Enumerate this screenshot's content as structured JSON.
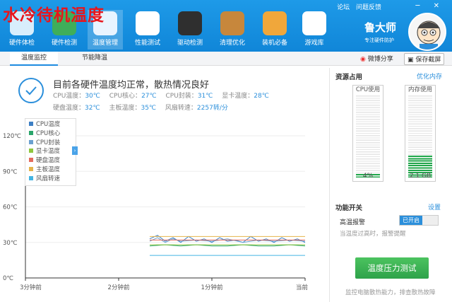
{
  "overlay_title": "水冷待机温度",
  "header": {
    "nav": [
      {
        "label": "硬件体检",
        "icon": "monitor-icon",
        "color": "#d8eefc"
      },
      {
        "label": "硬件检测",
        "icon": "board-icon",
        "color": "#3fae5a"
      },
      {
        "label": "温度管理",
        "icon": "temperature-chart-icon",
        "color": "#e8f4ff"
      },
      {
        "label": "性能测试",
        "icon": "gauge-icon",
        "color": "#ffffff"
      },
      {
        "label": "驱动检测",
        "icon": "gear-icon",
        "color": "#2f2f2f"
      },
      {
        "label": "清理优化",
        "icon": "broom-icon",
        "color": "#c7873c"
      },
      {
        "label": "装机必备",
        "icon": "box-icon",
        "color": "#f0a73b"
      },
      {
        "label": "游戏库",
        "icon": "gamepad-icon",
        "color": "#ffffff"
      }
    ],
    "links": [
      "论坛",
      "问题反馈"
    ],
    "window_controls": "─ ✕",
    "brand_name": "鲁大师",
    "brand_sub": "专注硬件防护"
  },
  "tabs": {
    "temperature": "温度监控",
    "energy": "节能降温",
    "share": "微博分享",
    "screenshot": "保存截屏"
  },
  "status": {
    "message": "目前各硬件温度均正常，散热情况良好",
    "cpu_temp": "CPU温度：",
    "cpu_temp_v": "30℃",
    "cpu_core": "CPU核心：",
    "cpu_core_v": "27℃",
    "cpu_pkg": "CPU封装：",
    "cpu_pkg_v": "31℃",
    "gpu_temp": "显卡温度：",
    "gpu_temp_v": "28℃",
    "disk_temp": "硬盘温度：",
    "disk_temp_v": "32℃",
    "board_temp": "主板温度：",
    "board_temp_v": "35℃",
    "fan_speed": "风扇转速：",
    "fan_speed_v": "2257转/分"
  },
  "chart_data": {
    "type": "line",
    "y_ticks": [
      "120℃",
      "90℃",
      "60℃",
      "30℃",
      "0℃"
    ],
    "x_ticks": [
      "3分钟前",
      "2分钟前",
      "1分钟前",
      "当前"
    ],
    "ylim": [
      0,
      120
    ],
    "x_range": [
      -180,
      0
    ],
    "grid": true,
    "legend_position": "top-left",
    "legend": [
      "CPU温度",
      "CPU核心",
      "CPU封装",
      "显卡温度",
      "硬盘温度",
      "主板温度",
      "风扇转速"
    ],
    "series": [
      {
        "name": "CPU温度",
        "color": "#3d7fc4",
        "values": [
          [
            -100,
            33
          ],
          [
            -95,
            36
          ],
          [
            -90,
            31
          ],
          [
            -85,
            34
          ],
          [
            -80,
            30
          ],
          [
            -75,
            35
          ],
          [
            -70,
            31
          ],
          [
            -65,
            33
          ],
          [
            -60,
            30
          ],
          [
            -55,
            34
          ],
          [
            -50,
            31
          ],
          [
            -45,
            32
          ],
          [
            -40,
            30
          ],
          [
            -35,
            35
          ],
          [
            -30,
            31
          ],
          [
            -25,
            33
          ],
          [
            -20,
            30
          ],
          [
            -15,
            34
          ],
          [
            -10,
            31
          ],
          [
            -5,
            33
          ],
          [
            0,
            30
          ]
        ]
      },
      {
        "name": "CPU核心",
        "color": "#2aa56b",
        "values": [
          [
            -100,
            27
          ],
          [
            -90,
            28
          ],
          [
            -80,
            27
          ],
          [
            -70,
            28
          ],
          [
            -60,
            27
          ],
          [
            -50,
            27
          ],
          [
            -40,
            28
          ],
          [
            -30,
            27
          ],
          [
            -20,
            27
          ],
          [
            -10,
            28
          ],
          [
            0,
            27
          ]
        ]
      },
      {
        "name": "CPU封装",
        "color": "#6aa0cf",
        "values": [
          [
            -100,
            31
          ],
          [
            -95,
            34
          ],
          [
            -90,
            30
          ],
          [
            -85,
            33
          ],
          [
            -80,
            31
          ],
          [
            -70,
            32
          ],
          [
            -60,
            31
          ],
          [
            -50,
            33
          ],
          [
            -40,
            30
          ],
          [
            -30,
            32
          ],
          [
            -20,
            31
          ],
          [
            -10,
            32
          ],
          [
            0,
            31
          ]
        ]
      },
      {
        "name": "显卡温度",
        "color": "#8fc63d",
        "values": [
          [
            -100,
            28
          ],
          [
            0,
            28
          ]
        ]
      },
      {
        "name": "硬盘温度",
        "color": "#e46a5d",
        "values": [
          [
            -100,
            32
          ],
          [
            0,
            32
          ]
        ]
      },
      {
        "name": "主板温度",
        "color": "#e5b44a",
        "values": [
          [
            -100,
            35
          ],
          [
            0,
            35
          ]
        ]
      },
      {
        "name": "风扇转速",
        "color": "#45b5e3",
        "values": [
          [
            -100,
            19
          ],
          [
            0,
            19
          ]
        ]
      }
    ]
  },
  "resources": {
    "title": "资源占用",
    "optimize": "优化内存",
    "cpu_label": "CPU使用",
    "cpu_value": "4%",
    "cpu_fraction": 0.04,
    "mem_label": "内存使用",
    "mem_value": "2.1 GB",
    "mem_fraction": 0.26
  },
  "functions": {
    "title": "功能开关",
    "settings": "设置",
    "hot_alarm": "高温报警",
    "hot_alarm_state": "已开启",
    "hot_alarm_desc": "当温度过高时，报警提醒",
    "stress_button": "温度压力测试",
    "stress_desc": "监控电脑散热能力，排查散热故障"
  }
}
